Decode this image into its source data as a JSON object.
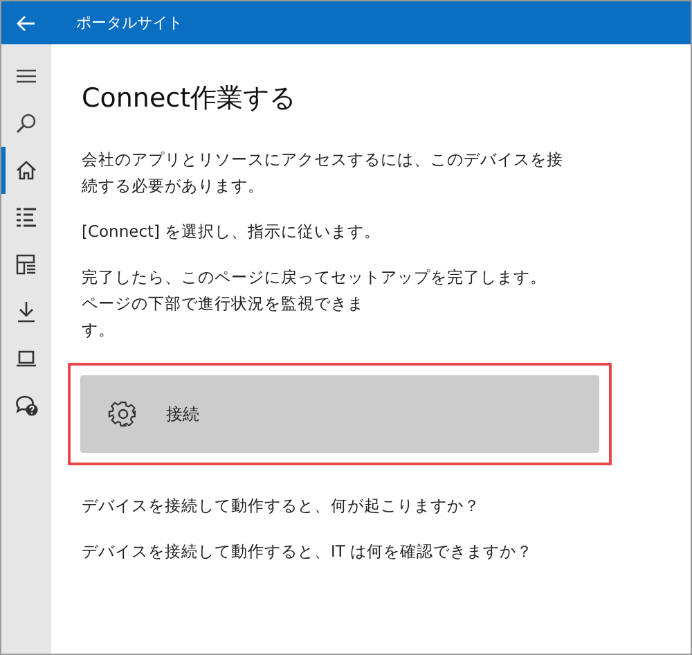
{
  "window": {
    "title": "ポータルサイト"
  },
  "sidebar": {
    "items": [
      {
        "selected": false
      },
      {
        "selected": false
      },
      {
        "selected": true
      },
      {
        "selected": false
      },
      {
        "selected": false
      },
      {
        "selected": false
      },
      {
        "selected": false
      },
      {
        "selected": false
      }
    ]
  },
  "page": {
    "heading": "Connect作業する",
    "paragraphs": [
      {
        "lines": [
          "会社のアプリとリソースにアクセスするには、このデバイスを接",
          "続する必要があります。"
        ]
      },
      {
        "lines": [
          "[Connect] を選択し、指示に従います。"
        ]
      },
      {
        "lines": [
          "完了したら、このページに戻ってセットアップを完了します。",
          "ページの下部で進行状況を監視できま",
          "す。"
        ]
      }
    ],
    "connect_button": {
      "label": "接続"
    },
    "links": [
      "デバイスを接続して動作すると、何が起こりますか？",
      "デバイスを接続して動作すると、IT は何を確認できますか？"
    ]
  }
}
